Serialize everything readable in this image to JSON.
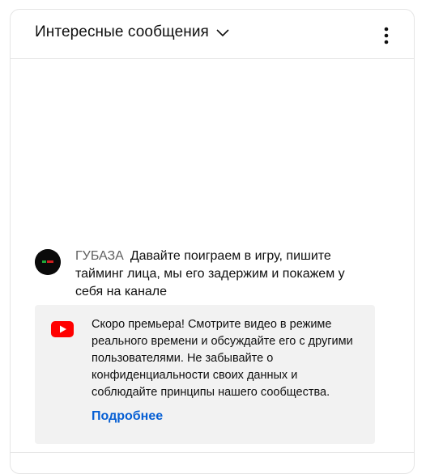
{
  "header": {
    "title": "Интересные сообщения",
    "chevron_icon": "chevron-down-icon",
    "more_icon": "more-vert-icon"
  },
  "message": {
    "author": "ГУБАЗА",
    "text": "Давайте поиграем в игру, пишите тайминг лица, мы его задержим и покажем у себя на канале",
    "avatar_icon": "channel-avatar"
  },
  "notice": {
    "icon": "youtube-logo-icon",
    "text": "Скоро премьера! Смотрите видео в режиме реального времени и обсуждайте его с другими пользователями. Не забывайте о конфиденциальности своих данных и соблюдайте принципы нашего сообщества.",
    "link_label": "Подробнее"
  },
  "colors": {
    "link": "#065fd4",
    "notice_bg": "#f2f2f2",
    "youtube_red": "#ff0000"
  }
}
